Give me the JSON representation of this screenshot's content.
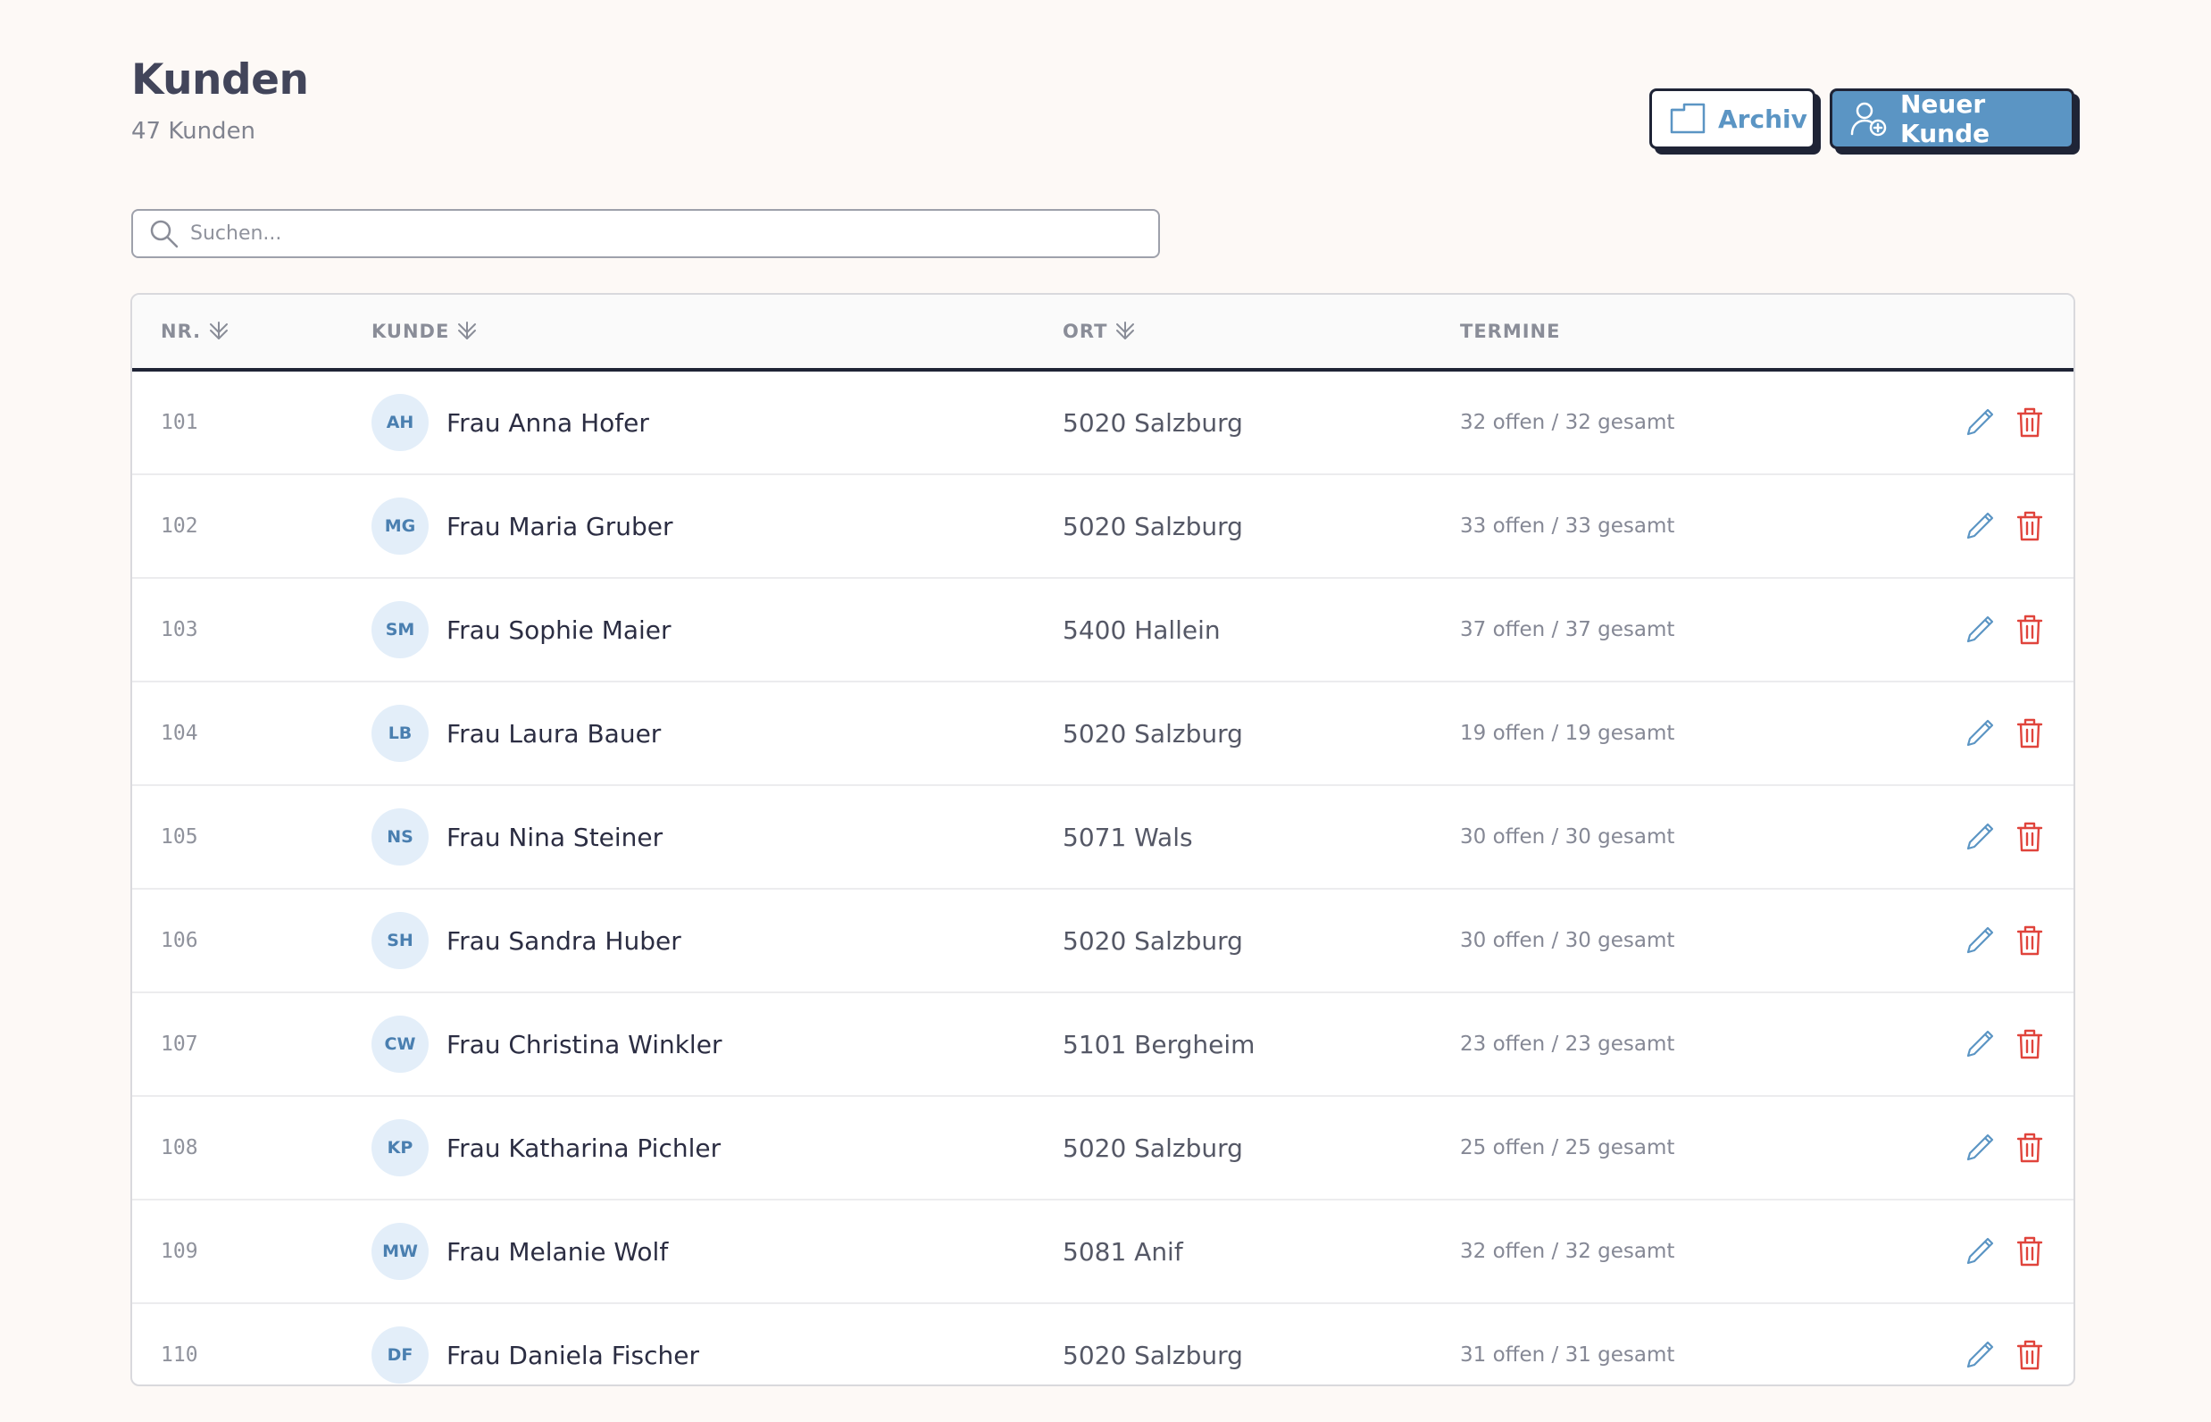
{
  "header": {
    "title": "Kunden",
    "subtitle": "47 Kunden",
    "archive_label": "Archiv",
    "new_customer_label": "Neuer Kunde"
  },
  "search": {
    "placeholder": "Suchen...",
    "value": ""
  },
  "table": {
    "columns": {
      "nr": "NR.",
      "kunde": "KUNDE",
      "ort": "ORT",
      "termine": "TERMINE"
    },
    "rows": [
      {
        "nr": "101",
        "initials": "AH",
        "name": "Frau Anna Hofer",
        "ort": "5020 Salzburg",
        "termine": "32 offen / 32 gesamt"
      },
      {
        "nr": "102",
        "initials": "MG",
        "name": "Frau Maria Gruber",
        "ort": "5020 Salzburg",
        "termine": "33 offen / 33 gesamt"
      },
      {
        "nr": "103",
        "initials": "SM",
        "name": "Frau Sophie Maier",
        "ort": "5400 Hallein",
        "termine": "37 offen / 37 gesamt"
      },
      {
        "nr": "104",
        "initials": "LB",
        "name": "Frau Laura Bauer",
        "ort": "5020 Salzburg",
        "termine": "19 offen / 19 gesamt"
      },
      {
        "nr": "105",
        "initials": "NS",
        "name": "Frau Nina Steiner",
        "ort": "5071 Wals",
        "termine": "30 offen / 30 gesamt"
      },
      {
        "nr": "106",
        "initials": "SH",
        "name": "Frau Sandra Huber",
        "ort": "5020 Salzburg",
        "termine": "30 offen / 30 gesamt"
      },
      {
        "nr": "107",
        "initials": "CW",
        "name": "Frau Christina Winkler",
        "ort": "5101 Bergheim",
        "termine": "23 offen / 23 gesamt"
      },
      {
        "nr": "108",
        "initials": "KP",
        "name": "Frau Katharina Pichler",
        "ort": "5020 Salzburg",
        "termine": "25 offen / 25 gesamt"
      },
      {
        "nr": "109",
        "initials": "MW",
        "name": "Frau Melanie Wolf",
        "ort": "5081 Anif",
        "termine": "32 offen / 32 gesamt"
      },
      {
        "nr": "110",
        "initials": "DF",
        "name": "Frau Daniela Fischer",
        "ort": "5020 Salzburg",
        "termine": "31 offen / 31 gesamt"
      }
    ]
  },
  "colors": {
    "background": "#fdf9f6",
    "accent": "#5b95c4",
    "danger": "#e0443c",
    "border_dark": "#1f2436"
  },
  "icons": {
    "archive": "folder-icon",
    "new_customer": "user-plus-icon",
    "search": "search-icon",
    "sort": "sort-chevrons-icon",
    "edit": "pencil-icon",
    "delete": "trash-icon"
  }
}
